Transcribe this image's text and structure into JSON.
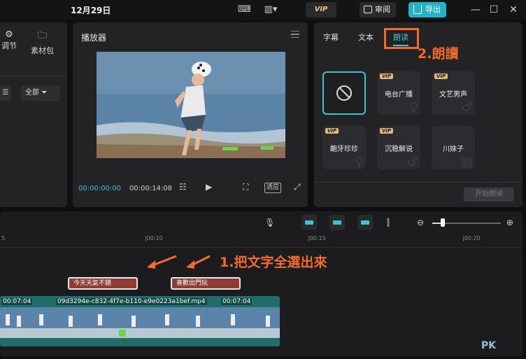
{
  "titlebar": {
    "date": "12月29日",
    "vip_label": "VIP",
    "review_label": "审阅",
    "export_label": "导出"
  },
  "left_panel": {
    "tab_adjust": "调节",
    "tab_material": "素材包",
    "filter_all": "全部"
  },
  "player": {
    "title": "播放器",
    "current_time": "00:00:00:00",
    "total_time": "00:00:14:08",
    "fit_label": "适应"
  },
  "right_panel": {
    "tabs": [
      "字幕",
      "文本",
      "朗读"
    ],
    "voices": [
      {
        "name": "",
        "vip": false
      },
      {
        "name": "电台广播",
        "vip": true
      },
      {
        "name": "文艺男声",
        "vip": true
      },
      {
        "name": "齙牙珍珍",
        "vip": true
      },
      {
        "name": "沉稳解说",
        "vip": true
      },
      {
        "name": "川妹子",
        "vip": false
      }
    ],
    "vip_tag": "VIP",
    "start_read": "开始朗读"
  },
  "annotations": {
    "step1": "1.把文字全選出來",
    "step2": "2.朗讀",
    "accent_color": "#f26b2a"
  },
  "timeline": {
    "ruler_labels": [
      "5",
      "|00:10",
      "|00:15",
      "|00:20"
    ],
    "text_clips": [
      "今天天氣不錯",
      "喜歡出門玩"
    ],
    "video_labels": [
      "00:07:04",
      "09d3294e-c832-4f7e-b110-e9e0223a1bef.mp4",
      "00:07:04"
    ]
  },
  "watermark": "PK"
}
